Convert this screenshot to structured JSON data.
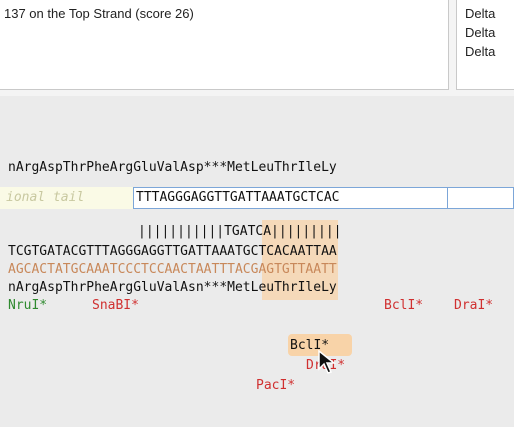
{
  "results_panel": {
    "primary_text": "137 on the Top Strand (score 26)",
    "side_lines": [
      "Delta",
      "Delta",
      "Delta"
    ]
  },
  "sequence_view": {
    "top_translation": "nArgAspThrPheArgGluValAsp***MetLeuThrIleLy",
    "tail_label": "ional tail",
    "primer_sequence": "TTTAGGGAGGTTGATTAAATGCTCAC",
    "match_bars": "|||||||||||TGATCA|||||||||",
    "site_label": "TGATCA",
    "forward_strand": "TCGTGATACGTTTAGGGAGGTTGATTAAATGCTCACAATTAA",
    "reverse_strand": "AGCACTATGCAAATCCCTCCAACTAATTTACGAGTGTTAATT",
    "bottom_translation": "nArgAspThrPheArgGluValAsn***MetLeuThrIleLy",
    "enzymes_row1": {
      "nrui": "NruI*",
      "snabi": "SnaBI*",
      "bcli_hl": "BclI*",
      "bcli": "BclI*",
      "drai": "DraI*"
    },
    "enzymes_row2": "DraI*",
    "enzymes_row3": "PacI*",
    "colors": {
      "accent_green": "#2f8a2f",
      "accent_red": "#d03030",
      "highlight": "#f8d3a8",
      "primer_border": "#7ca6d8"
    }
  }
}
